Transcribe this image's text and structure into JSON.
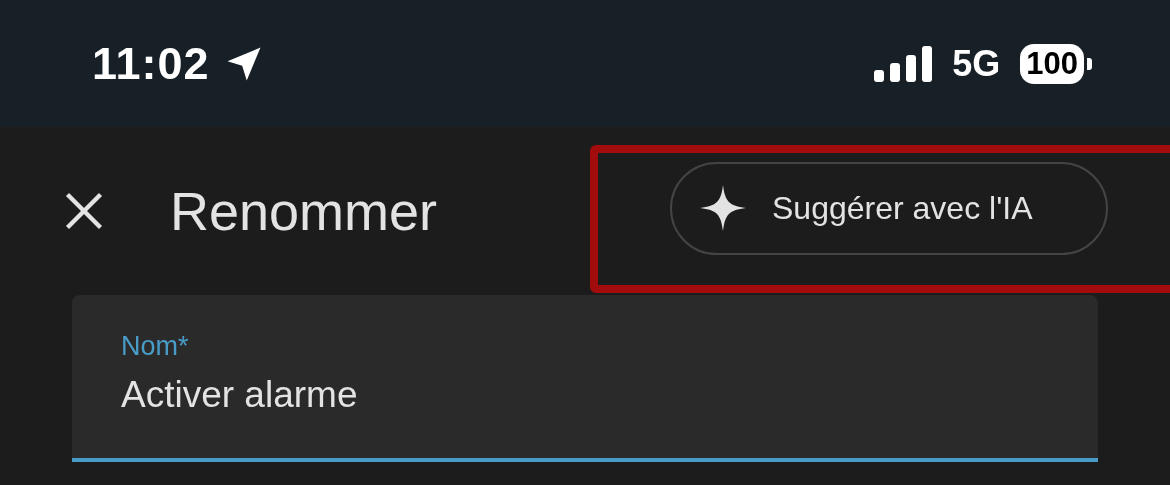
{
  "status_bar": {
    "time": "11:02",
    "network": "5G",
    "battery": "100"
  },
  "header": {
    "title": "Renommer",
    "suggest_button": {
      "label": "Suggérer avec l'IA",
      "highlighted": true
    }
  },
  "field": {
    "label": "Nom*",
    "value": "Activer alarme",
    "focused": true
  }
}
